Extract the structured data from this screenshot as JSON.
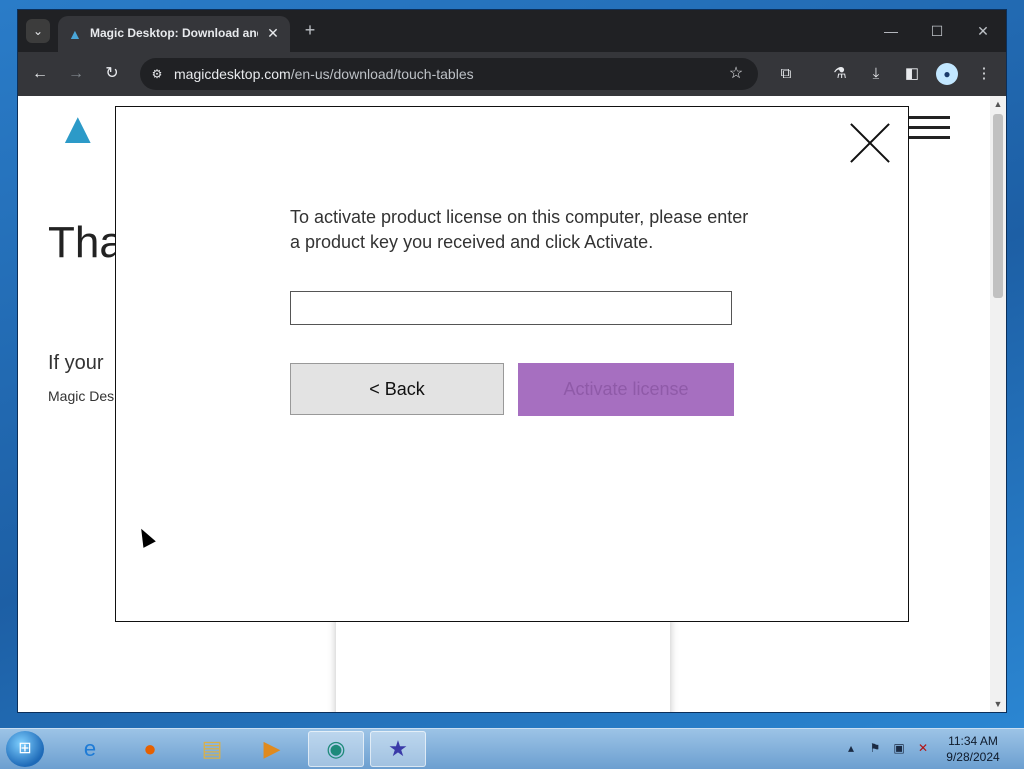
{
  "browser": {
    "tab_title": "Magic Desktop: Download and Install",
    "url_host": "magicdesktop.com",
    "url_path": "/en-us/download/touch-tables"
  },
  "page": {
    "heading_visible": "Tha",
    "subheading_visible": "If your",
    "small_text_visible": "Magic Des"
  },
  "modal": {
    "instructions": "To activate product license on this computer, please enter a product key you received and click Activate.",
    "product_key_value": "",
    "back_label": "< Back",
    "activate_label": "Activate license"
  },
  "taskbar": {
    "time": "11:34 AM",
    "date": "9/28/2024"
  },
  "colors": {
    "activate_bg": "#a66fc0",
    "back_bg": "#e3e3e3",
    "logo": "#2c9ac8"
  }
}
